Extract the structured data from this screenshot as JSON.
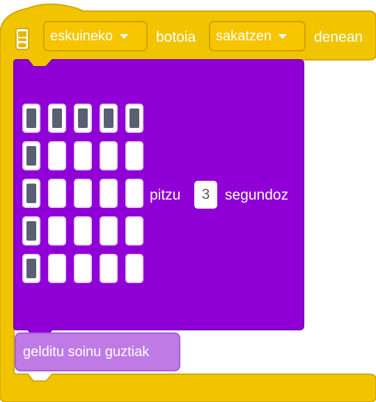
{
  "event": {
    "dropdown_button": "eskuineko",
    "word_button": "botoia",
    "dropdown_action": "sakatzen",
    "word_when": "denean"
  },
  "show_leds": {
    "pattern": [
      [
        1,
        1,
        1,
        1,
        1
      ],
      [
        1,
        0,
        0,
        0,
        0
      ],
      [
        1,
        0,
        0,
        0,
        0
      ],
      [
        1,
        0,
        0,
        0,
        0
      ],
      [
        1,
        0,
        0,
        0,
        0
      ]
    ],
    "label_before": "pitzu",
    "seconds": "3",
    "label_after": "segundoz"
  },
  "stop_block": {
    "label": "gelditu soinu guztiak"
  },
  "colors": {
    "event_yellow": "#f1c400",
    "led_purple": "#9000d6",
    "sound_purple": "#c07ae6"
  }
}
